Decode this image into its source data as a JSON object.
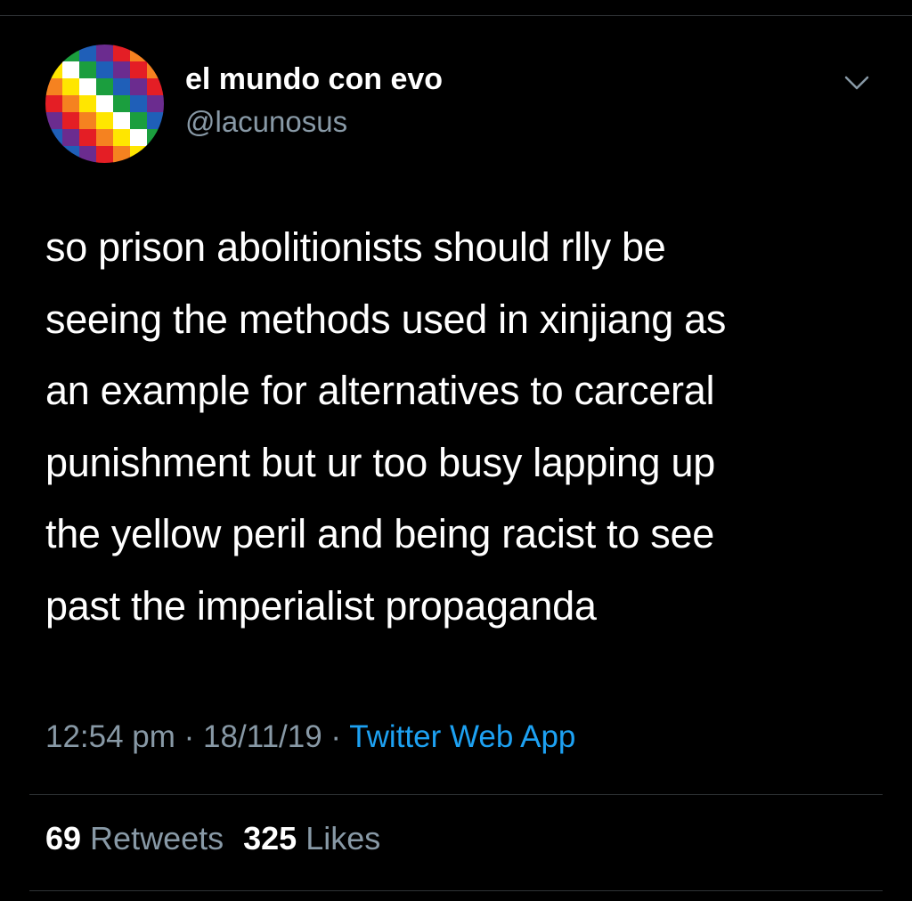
{
  "user": {
    "display_name": "el mundo con evo",
    "handle": "@lacunosus",
    "avatar_icon": "wiphala-flag-avatar"
  },
  "tweet": {
    "lines": [
      "so prison abolitionists should rlly be",
      "seeing the methods used in xinjiang as",
      "an example for alternatives to carceral",
      "punishment but ur too busy lapping up",
      "the yellow peril and being racist to see",
      "past the imperialist propaganda"
    ]
  },
  "meta": {
    "time": "12:54 pm",
    "separator": " · ",
    "date": "18/11/19",
    "app": "Twitter Web App"
  },
  "stats": {
    "retweets_count": "69",
    "retweets_label": " Retweets",
    "likes_count": "325",
    "likes_label": " Likes"
  },
  "colors": {
    "background": "#000000",
    "text": "#ffffff",
    "muted": "#8899a6",
    "link": "#1da1f2",
    "divider": "#2f3336"
  }
}
